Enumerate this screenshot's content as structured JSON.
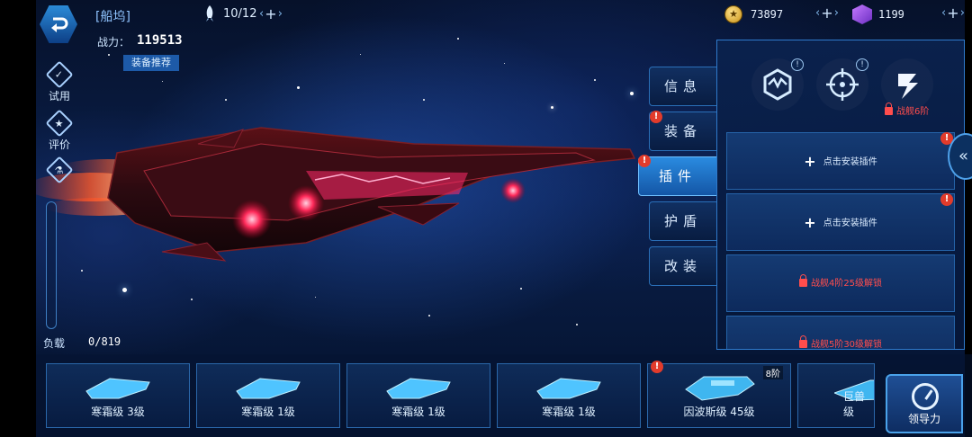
{
  "header": {
    "dock_title": "[船坞]",
    "power_label": "战力：",
    "power_value": "119513",
    "equip_recommend": "装备推荐",
    "slots": "10/12",
    "coins": "73897",
    "gems": "1199"
  },
  "sidebar": {
    "trial": "试用",
    "review": "评价",
    "load_label": "负载",
    "load_value": "0/819"
  },
  "tabs": [
    {
      "label": "信息",
      "alert": false
    },
    {
      "label": "装备",
      "alert": true
    },
    {
      "label": "插件",
      "alert": true,
      "active": true
    },
    {
      "label": "护盾",
      "alert": false
    },
    {
      "label": "改装",
      "alert": false
    }
  ],
  "plugin_panel": {
    "category_lock_label": "战舰6阶",
    "slots": [
      {
        "text": "点击安装插件",
        "locked": false
      },
      {
        "text": "点击安装插件",
        "locked": false
      },
      {
        "text": "战舰4阶25级解锁",
        "locked": true
      },
      {
        "text": "战舰5阶30级解锁",
        "locked": true
      }
    ]
  },
  "ship_list": [
    {
      "name": "寒霜级 3级"
    },
    {
      "name": "寒霜级 1级"
    },
    {
      "name": "寒霜级 1级"
    },
    {
      "name": "寒霜级 1级"
    },
    {
      "name": "因波斯级 45级",
      "tier": "8阶",
      "alert": true
    },
    {
      "name": "巨兽级"
    }
  ],
  "leadership_label": "领导力",
  "colors": {
    "accent": "#2a8be0",
    "alert": "#e23b2b",
    "lock_text": "#ff4d4d"
  }
}
